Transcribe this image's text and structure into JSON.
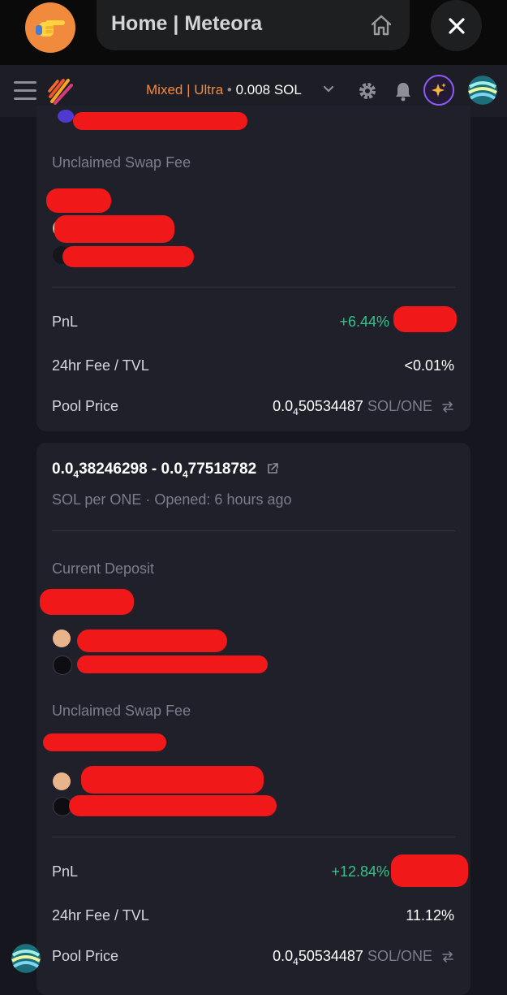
{
  "browser": {
    "title": "Home | Meteora"
  },
  "header": {
    "mode": "Mixed",
    "mode_sep": "|",
    "mode2": "Ultra",
    "dot": "•",
    "balance": "0.008 SOL"
  },
  "card1": {
    "unclaimed_label": "Unclaimed Swap Fee",
    "pnl_label": "PnL",
    "pnl_value": "+6.44%",
    "fee_tvl_label": "24hr Fee / TVL",
    "fee_tvl_value": "<0.01%",
    "pool_price_label": "Pool Price",
    "pool_price_prefix": "0.0",
    "pool_price_sub": "4",
    "pool_price_rest": "50534487",
    "pool_price_unit": "SOL/ONE"
  },
  "card2": {
    "range_a_prefix": "0.0",
    "range_a_sub": "4",
    "range_a_rest": "38246298",
    "range_dash": " - ",
    "range_b_prefix": "0.0",
    "range_b_sub": "4",
    "range_b_rest": "77518782",
    "subtitle": "SOL per ONE · Opened: 6 hours ago",
    "deposit_label": "Current Deposit",
    "unclaimed_label": "Unclaimed Swap Fee",
    "pnl_label": "PnL",
    "pnl_value": "+12.84%",
    "fee_tvl_label": "24hr Fee / TVL",
    "fee_tvl_value": "11.12%",
    "pool_price_label": "Pool Price",
    "pool_price_prefix": "0.0",
    "pool_price_sub": "4",
    "pool_price_rest": "50534487",
    "pool_price_unit": "SOL/ONE"
  },
  "colors": {
    "accent_orange": "#f58a3a",
    "positive_green": "#34c48a",
    "redaction_red": "#f01818"
  }
}
